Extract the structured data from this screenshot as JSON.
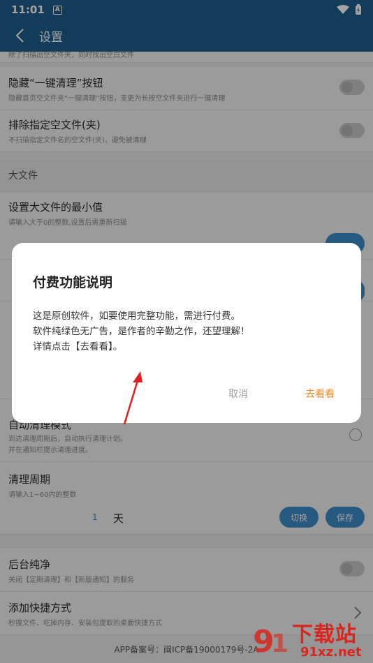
{
  "status_bar": {
    "time": "11:01",
    "notification": "A"
  },
  "app_bar": {
    "title": "设置"
  },
  "settings": {
    "partial_row_subtitle": "除了扫描出空文件夹，同时找出空白文件",
    "hide_clean_button": {
      "title": "隐藏“一键清理”按钮",
      "subtitle": "隐藏首页空文件夹“一键清理”按钮，变更为长按空文件夹进行一键清理"
    },
    "exclude_empty": {
      "title": "排除指定空文件(夹)",
      "subtitle": "不扫描指定文件名的空文件(夹)，避免被清理"
    },
    "large_file_section": "大文件",
    "large_file_min": {
      "title": "设置大文件的最小值",
      "subtitle": "请输入大于0的整数,设置后需重新扫描"
    },
    "auto_clean": {
      "title": "自动清理模式",
      "subtitle_line1": "到达清理周期后，自动执行清理计划。",
      "subtitle_line2": "并在通知栏提示清理进度。"
    },
    "clean_cycle": {
      "title": "清理周期",
      "subtitle": "请输入1~60内的整数",
      "value": "1",
      "unit": "天",
      "switch_label": "切换",
      "save_label": "保存"
    },
    "background_clean": {
      "title": "后台纯净",
      "subtitle": "关闭【定期清理】和【新版通知】的服务"
    },
    "shortcut": {
      "title": "添加快捷方式",
      "subtitle": "秒搜文件、吃掉内存、安装包提取的桌面快捷方式"
    },
    "footer": "APP备案号：闽ICP备19000179号-2A"
  },
  "dialog": {
    "title": "付费功能说明",
    "line1": "这是原创软件，如要使用完整功能，需进行付费。",
    "line2": "软件纯绿色无广告，是作者的辛勤之作，还望理解！",
    "line3": "详情点击【去看看】。",
    "cancel_label": "取消",
    "goto_label": "去看看"
  },
  "watermark": {
    "text": "下载站",
    "url": "91xz.net"
  },
  "colors": {
    "app_bar": "#1e5f8f",
    "accent_orange": "#f08a24",
    "pill_blue": "#3a8bc7",
    "watermark_red": "#d8261e"
  }
}
